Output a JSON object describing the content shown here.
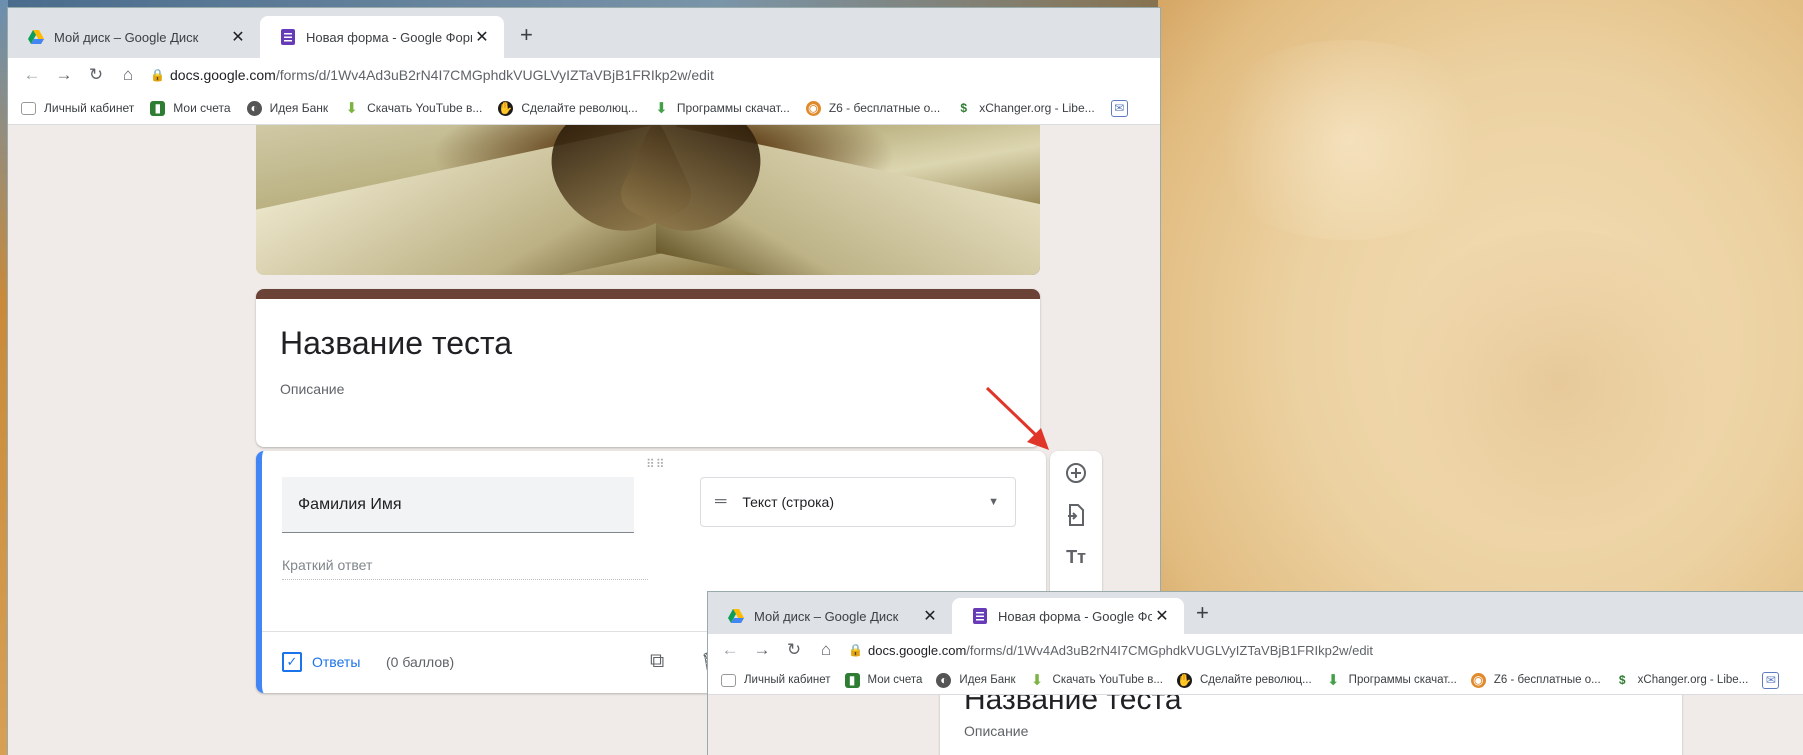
{
  "browser": {
    "tabs": [
      {
        "title": "Мой диск – Google Диск",
        "favicon": "google-drive-icon"
      },
      {
        "title": "Новая форма - Google Формы",
        "favicon": "google-forms-icon"
      }
    ],
    "url_host": "docs.google.com",
    "url_path": "/forms/d/1Wv4Ad3uB2rN4I7CMGphdkVUGLVyIZTaVBjB1FRIkp2w/edit",
    "bookmarks": [
      {
        "label": "Личный кабинет",
        "icon": "page-icon"
      },
      {
        "label": "Мои счета",
        "icon": "bank-icon"
      },
      {
        "label": "Идея Банк",
        "icon": "globe-icon"
      },
      {
        "label": "Скачать YouTube в...",
        "icon": "download-icon"
      },
      {
        "label": "Сделайте революц...",
        "icon": "hand-icon"
      },
      {
        "label": "Программы скачат...",
        "icon": "download-icon"
      },
      {
        "label": "Z6 - бесплатные о...",
        "icon": "owl-icon"
      },
      {
        "label": "xChanger.org - Libe...",
        "icon": "dollar-icon"
      }
    ]
  },
  "form": {
    "title": "Название теста",
    "description": "Описание",
    "accent_color": "#6b4236",
    "question": {
      "text": "Фамилия Имя",
      "type": "Текст (строка)",
      "answer_placeholder": "Краткий ответ",
      "answers_label": "Ответы",
      "points": "(0 баллов)"
    }
  },
  "colors": {
    "highlight_arrow": "#e0362a",
    "question_accent": "#4285f4"
  }
}
